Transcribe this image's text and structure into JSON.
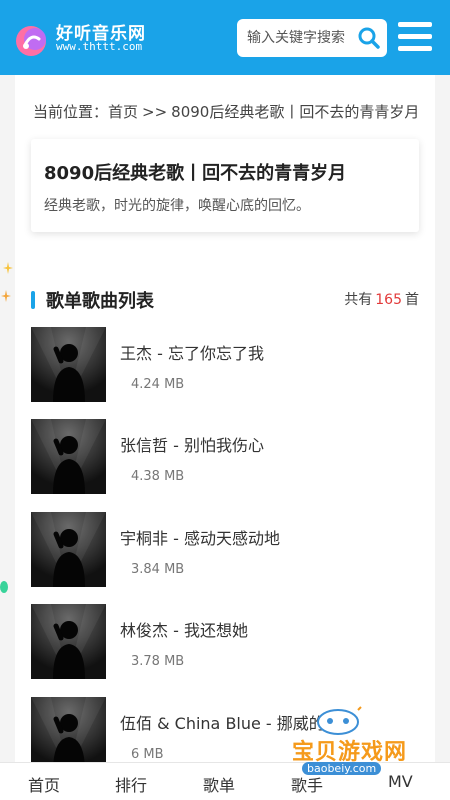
{
  "header": {
    "logo_cn": "好听音乐网",
    "logo_en": "www.thttt.com",
    "search_placeholder": "输入关键字搜索",
    "accent_color": "#1aa3e8"
  },
  "breadcrumb": {
    "prefix": "当前位置：",
    "home": "首页",
    "separator": ">>",
    "current": "8090后经典老歌丨回不去的青青岁月"
  },
  "playlist": {
    "title": "8090后经典老歌丨回不去的青青岁月",
    "description": "经典老歌，时光的旋律，唤醒心底的回忆。"
  },
  "song_list": {
    "heading": "歌单歌曲列表",
    "count_prefix": "共有",
    "count": "165",
    "count_suffix": "首",
    "songs": [
      {
        "title": "王杰 - 忘了你忘了我",
        "size": "4.24 MB"
      },
      {
        "title": "张信哲 - 别怕我伤心",
        "size": "4.38 MB"
      },
      {
        "title": "宇桐非 - 感动天感动地",
        "size": "3.84 MB"
      },
      {
        "title": "林俊杰 - 我还想她",
        "size": "3.78 MB"
      },
      {
        "title": "伍佰 & China Blue - 挪威的森林",
        "size": "6 MB"
      }
    ]
  },
  "bottom_nav": {
    "items": [
      "首页",
      "排行",
      "歌单",
      "歌手",
      "MV"
    ]
  },
  "watermark": {
    "text": "宝贝游戏网",
    "url": "baobeiy.com"
  }
}
